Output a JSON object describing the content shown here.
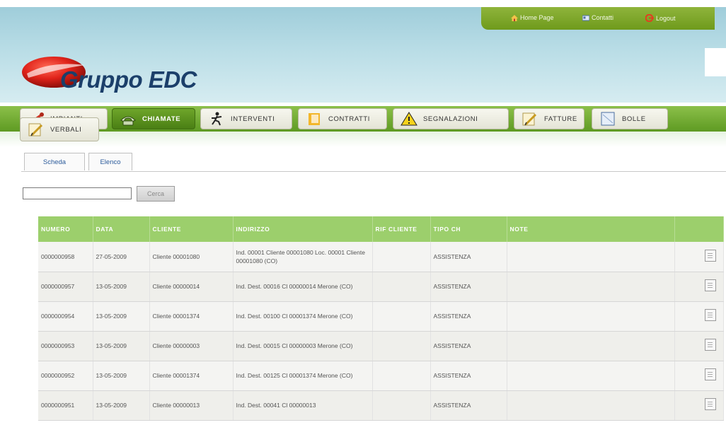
{
  "topnav": {
    "home": "Home Page",
    "contacts": "Contatti",
    "logout": "Logout"
  },
  "logo": {
    "text": "Gruppo EDC"
  },
  "tabs": [
    {
      "label": "IMPIANTI",
      "icon": "pipe-icon"
    },
    {
      "label": "CHIAMATE",
      "icon": "phone-icon"
    },
    {
      "label": "INTERVENTI",
      "icon": "worker-icon"
    },
    {
      "label": "CONTRATTI",
      "icon": "folder-icon"
    },
    {
      "label": "SEGNALAZIONI",
      "icon": "warning-icon"
    },
    {
      "label": "FATTURE",
      "icon": "pen-document-icon"
    },
    {
      "label": "BOLLE",
      "icon": "document-icon"
    },
    {
      "label": "VERBALI",
      "icon": "pen-document-icon"
    }
  ],
  "subtabs": {
    "scheda": "Scheda",
    "elenco": "Elenco"
  },
  "search": {
    "button": "Cerca",
    "value": ""
  },
  "table": {
    "headers": [
      "NUMERO",
      "DATA",
      "CLIENTE",
      "INDIRIZZO",
      "RIF CLIENTE",
      "TIPO CH",
      "NOTE",
      ""
    ],
    "rows": [
      {
        "numero": "0000000958",
        "data": "27-05-2009",
        "cliente": "Cliente 00001080",
        "indirizzo": "Ind. 00001 Cliente 00001080 Loc. 00001 Cliente 00001080 (CO)",
        "rif": "",
        "tipo": "ASSISTENZA",
        "note": ""
      },
      {
        "numero": "0000000957",
        "data": "13-05-2009",
        "cliente": "Cliente 00000014",
        "indirizzo": "Ind. Dest. 00016 Cl 00000014 Merone (CO)",
        "rif": "",
        "tipo": "ASSISTENZA",
        "note": ""
      },
      {
        "numero": "0000000954",
        "data": "13-05-2009",
        "cliente": "Cliente 00001374",
        "indirizzo": "Ind. Dest. 00100 Cl 00001374 Merone (CO)",
        "rif": "",
        "tipo": "ASSISTENZA",
        "note": ""
      },
      {
        "numero": "0000000953",
        "data": "13-05-2009",
        "cliente": "Cliente 00000003",
        "indirizzo": "Ind. Dest. 00015 Cl 00000003 Merone (CO)",
        "rif": "",
        "tipo": "ASSISTENZA",
        "note": ""
      },
      {
        "numero": "0000000952",
        "data": "13-05-2009",
        "cliente": "Cliente 00001374",
        "indirizzo": "Ind. Dest. 00125 Cl 00001374 Merone (CO)",
        "rif": "",
        "tipo": "ASSISTENZA",
        "note": ""
      },
      {
        "numero": "0000000951",
        "data": "13-05-2009",
        "cliente": "Cliente 00000013",
        "indirizzo": "Ind. Dest. 00041 Cl 00000013",
        "rif": "",
        "tipo": "ASSISTENZA",
        "note": ""
      }
    ]
  },
  "colors": {
    "accent": "#6ea52a",
    "header_bg": "#a8d3de",
    "table_header": "#9ccf6c",
    "logo_red": "#d8201a",
    "logo_text": "#1b3f6a"
  }
}
